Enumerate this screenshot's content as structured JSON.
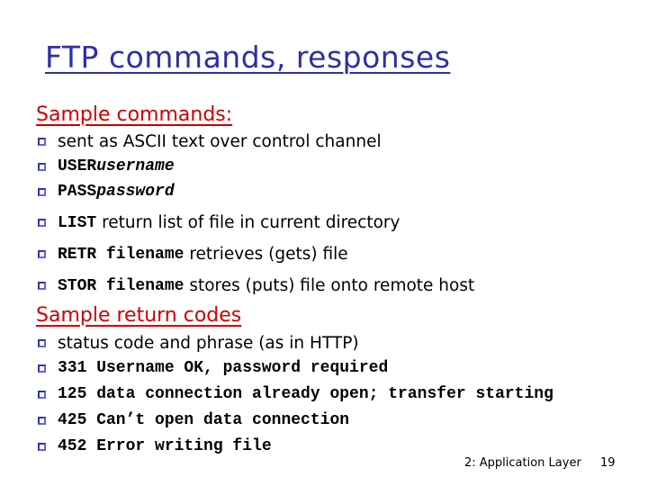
{
  "title": "FTP commands, responses",
  "sections": {
    "commands": {
      "heading": "Sample commands:",
      "items": [
        {
          "text": "sent as ASCII text over control channel"
        },
        {
          "cmd": "USER ",
          "arg": "username"
        },
        {
          "cmd": "PASS ",
          "arg": "password"
        },
        {
          "cmd": "LIST",
          "text": " return list of file in current directory"
        },
        {
          "cmd": "RETR filename",
          "text": " retrieves (gets) file"
        },
        {
          "cmd": "STOR filename",
          "text": " stores (puts) file onto remote host"
        }
      ]
    },
    "codes": {
      "heading": "Sample return codes",
      "items": [
        {
          "text": "status code and phrase (as in HTTP)"
        },
        {
          "code": "331 Username OK, password required"
        },
        {
          "code": "125 data connection already open; transfer starting"
        },
        {
          "code": "425 Can’t open data connection"
        },
        {
          "code": "452 Error writing file"
        }
      ]
    }
  },
  "footer": {
    "chapter": "2: Application Layer",
    "page": "19"
  },
  "colors": {
    "title": "#2f2fa8",
    "section_heading": "#cc0000",
    "bullet": "#3333aa"
  }
}
